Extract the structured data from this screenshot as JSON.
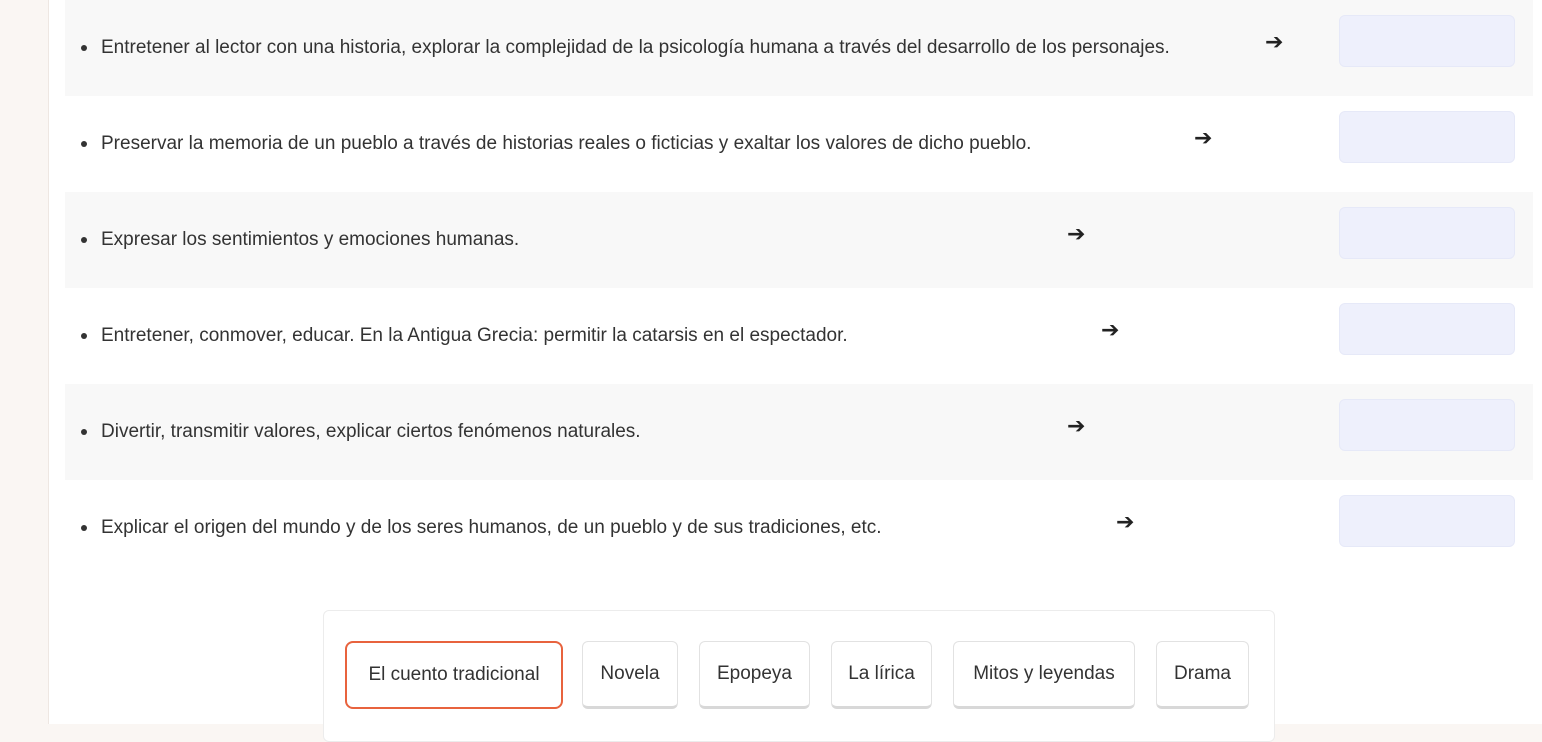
{
  "rows": [
    {
      "text": "Entretener al lector con una historia, explorar la complejidad de la psicología humana a través del desarrollo de los personajes.",
      "arrow": "➔"
    },
    {
      "text": "Preservar la memoria de un pueblo a través de historias reales o ficticias y exaltar los valores de dicho pueblo.",
      "arrow": "➔"
    },
    {
      "text": "Expresar los sentimientos y emociones humanas.",
      "arrow": "➔"
    },
    {
      "text": "Entretener, conmover, educar. En la Antigua Grecia: permitir la catarsis en el espectador.",
      "arrow": "➔"
    },
    {
      "text": "Divertir, transmitir valores, explicar ciertos fenómenos naturales.",
      "arrow": "➔"
    },
    {
      "text": "Explicar el origen del mundo y de los seres humanos, de un pueblo y de sus tradiciones, etc.",
      "arrow": "➔"
    }
  ],
  "bank": {
    "options": [
      {
        "label": "El cuento tradicional",
        "selected": true
      },
      {
        "label": "Novela",
        "selected": false
      },
      {
        "label": "Epopeya",
        "selected": false
      },
      {
        "label": "La lírica",
        "selected": false
      },
      {
        "label": "Mitos y leyendas",
        "selected": false
      },
      {
        "label": "Drama",
        "selected": false
      }
    ]
  },
  "colors": {
    "accent": "#e8633e",
    "drop_zone": "#eef0fc",
    "row_shade": "#f8f8f8"
  },
  "icons": {
    "arrow": "arrow-right-icon",
    "bullet": "bullet-icon"
  }
}
